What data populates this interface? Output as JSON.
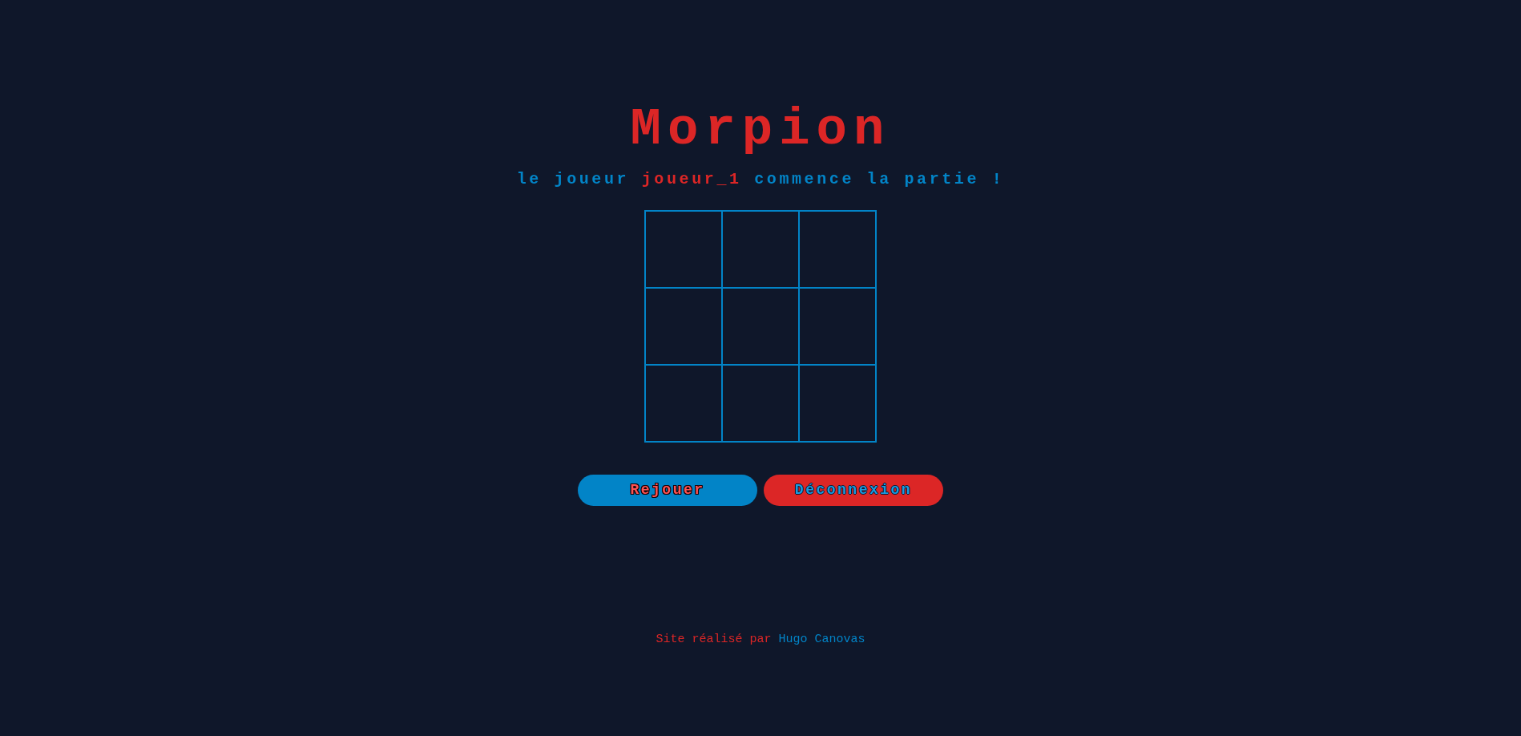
{
  "title": "Morpion",
  "turn_message": {
    "before": "le joueur",
    "player": "joueur_1",
    "after": "commence la partie !"
  },
  "board": {
    "rows": [
      [
        {
          "kind": "empty"
        },
        {
          "kind": "empty"
        },
        {
          "kind": "empty"
        }
      ],
      [
        {
          "kind": "empty"
        },
        {
          "kind": "empty"
        },
        {
          "kind": "empty"
        }
      ],
      [
        {
          "kind": "empty"
        },
        {
          "kind": "empty"
        },
        {
          "kind": "empty"
        }
      ]
    ]
  },
  "buttons": [
    {
      "label": "Rejouer",
      "kind": "replay"
    },
    {
      "label": "Déconnexion",
      "kind": "logout"
    }
  ],
  "footer": {
    "text": "Site réalisé par",
    "author": "Hugo Canovas"
  }
}
